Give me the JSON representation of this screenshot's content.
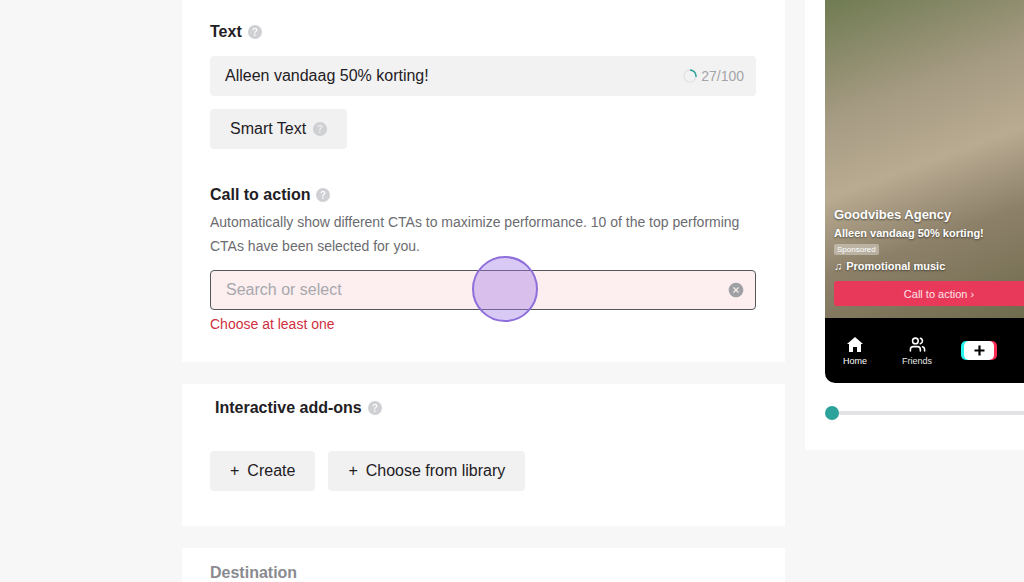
{
  "text_field": {
    "label": "Text",
    "value": "Alleen vandaag 50% korting!",
    "counter": "27/100",
    "level": 0.27
  },
  "smart_text_button": {
    "label": "Smart Text"
  },
  "call_to_action": {
    "label": "Call to action",
    "description": "Automatically show different CTAs to maximize performance. 10 of the top performing CTAs have been selected for you.",
    "placeholder": "Search or select",
    "error": "Choose at least one",
    "invalid": true,
    "focused": true
  },
  "interactive_addons": {
    "label": "Interactive add-ons",
    "buttons": [
      {
        "icon": "+",
        "label": "Create"
      },
      {
        "icon": "+",
        "label": "Choose from library"
      }
    ]
  },
  "destination": {
    "label": "Destination"
  },
  "preview": {
    "account": "Goodvibes Agency",
    "caption": "Alleen vandaag 50% korting!",
    "badge": "Sponsored",
    "music": {
      "icon": "♫",
      "label": "Promotional music"
    },
    "cta": "Call to action ›",
    "nav": [
      {
        "kind": "home",
        "label": "Home",
        "selected": true
      },
      {
        "kind": "friends",
        "label": "Friends",
        "selected": false
      },
      {
        "kind": "create",
        "selected": false
      }
    ],
    "timeline": {
      "level": 0
    }
  },
  "click_marker": {
    "shown": true
  }
}
